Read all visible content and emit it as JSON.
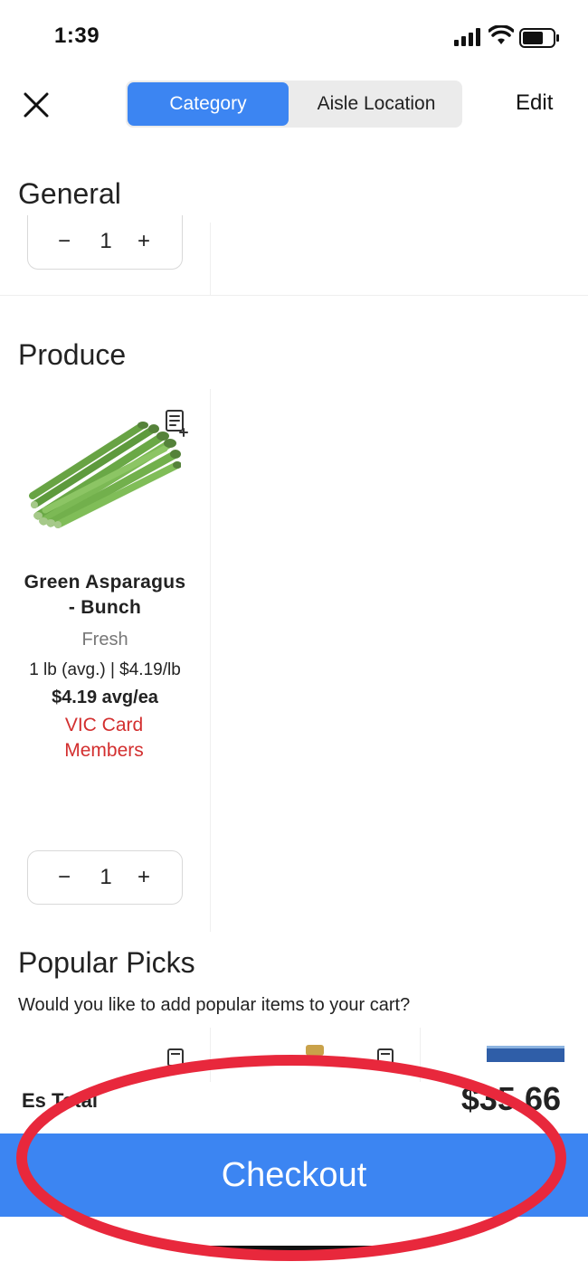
{
  "status_bar": {
    "time": "1:39"
  },
  "nav": {
    "close_icon": "close-icon",
    "tabs": [
      {
        "label": "Category",
        "active": true
      },
      {
        "label": "Aisle Location",
        "active": false
      }
    ],
    "edit_label": "Edit"
  },
  "sections": {
    "general": {
      "title": "General",
      "stepper": {
        "minus": "−",
        "qty": "1",
        "plus": "+"
      }
    },
    "produce": {
      "title": "Produce",
      "product": {
        "name_line1": "Green Asparagus",
        "name_line2": "- Bunch",
        "tag": "Fresh",
        "unit": "1 lb (avg.) | $4.19/lb",
        "price": "$4.19 avg/ea",
        "promo_line1": "VIC Card",
        "promo_line2": "Members",
        "stepper": {
          "minus": "−",
          "qty": "1",
          "plus": "+"
        }
      }
    },
    "popular_picks": {
      "title": "Popular Picks",
      "subtitle": "Would you like to add popular items to your cart?"
    }
  },
  "totals": {
    "label": "Est. Total",
    "label_visible": "Es  Total",
    "value": "$35.66",
    "value_visible": "$35.66"
  },
  "checkout": {
    "label": "Checkout"
  },
  "colors": {
    "accent": "#3c85f2",
    "promo": "#d32f2f",
    "annotation": "#e8283c"
  }
}
